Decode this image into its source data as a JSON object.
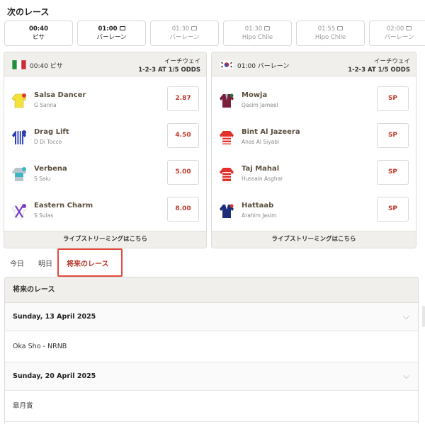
{
  "header": {
    "title": "次のレース"
  },
  "strip": [
    {
      "time": "00:40",
      "venue": "ピサ",
      "active": true,
      "tv": false
    },
    {
      "time": "01:00",
      "venue": "バーレーン",
      "active": true,
      "tv": true
    },
    {
      "time": "01:30",
      "venue": "バーレーン",
      "active": false,
      "tv": true
    },
    {
      "time": "01:30",
      "venue": "Hipo Chile",
      "active": false,
      "tv": true
    },
    {
      "time": "01:55",
      "venue": "Hipo Chile",
      "active": false,
      "tv": true
    },
    {
      "time": "02:00",
      "venue": "バーレーン",
      "active": false,
      "tv": true
    }
  ],
  "cards": [
    {
      "race": "00:40 ピサ",
      "flag": "italy-flag",
      "terms_line1": "イーチウェイ",
      "terms_line2": "1-2-3 AT 1/5 ODDS",
      "footer": "ライブストリーミングはこちら",
      "runners": [
        {
          "name": "Salsa Dancer",
          "jockey": "G Sanna",
          "odds": "2.87",
          "silk": "yellow-silk"
        },
        {
          "name": "Drag Lift",
          "jockey": "D Di Tocco",
          "odds": "4.50",
          "silk": "blue-stripes-silk"
        },
        {
          "name": "Verbena",
          "jockey": "S Saiu",
          "odds": "5.00",
          "silk": "teal-silk"
        },
        {
          "name": "Eastern Charm",
          "jockey": "S Sulas",
          "odds": "8.00",
          "silk": "white-purple-cross-silk"
        }
      ]
    },
    {
      "race": "01:00 バーレーン",
      "flag": "korea-flag",
      "terms_line1": "イーチウェイ",
      "terms_line2": "1-2-3 AT 1/5 ODDS",
      "footer": "ライブストリーミングはこちら",
      "runners": [
        {
          "name": "Mowja",
          "jockey": "Qasim Jameel",
          "odds": "SP",
          "silk": "maroon-silk"
        },
        {
          "name": "Bint Al Jazeera",
          "jockey": "Anas Al Siyabi",
          "odds": "SP",
          "silk": "red-hoops-silk"
        },
        {
          "name": "Taj Mahal",
          "jockey": "Hussain Asghar",
          "odds": "SP",
          "silk": "red-white-silk"
        },
        {
          "name": "Hattaab",
          "jockey": "Arahim Jasim",
          "odds": "SP",
          "silk": "navy-silk"
        }
      ]
    }
  ],
  "day_tabs": [
    {
      "label": "今日"
    },
    {
      "label": "明日"
    },
    {
      "label": "将来のレース"
    }
  ],
  "future": {
    "title": "将来のレース",
    "groups": [
      {
        "date": "Sunday, 13 April 2025",
        "race": "Oka Sho - NRNB"
      },
      {
        "date": "Sunday, 20 April 2025",
        "race": "皐月賞"
      }
    ]
  },
  "colors": {
    "accent": "#b5362a",
    "odds": "#c0392b",
    "panel": "#f1efeb"
  }
}
